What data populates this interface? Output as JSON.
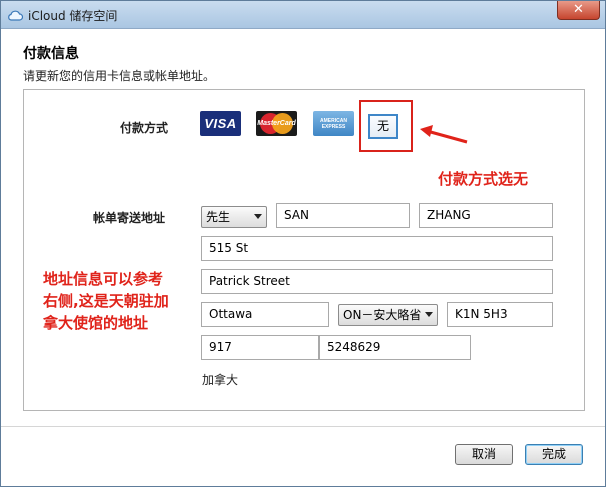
{
  "window": {
    "title": "iCloud 储存空间",
    "close_label": "✕"
  },
  "header": {
    "title": "付款信息",
    "subtitle": "请更新您的信用卡信息或帐单地址。"
  },
  "payment": {
    "label": "付款方式",
    "cards": {
      "visa": "VISA",
      "mastercard": "MasterCard",
      "amex_line1": "AMERICAN",
      "amex_line2": "EXPRESS"
    },
    "none_label": "无"
  },
  "billing": {
    "label": "帐单寄送地址",
    "salutation": "先生",
    "first_name": "SAN",
    "last_name": "ZHANG",
    "street1": "515 St",
    "street2": "Patrick Street",
    "city": "Ottawa",
    "province": "ON－安大略省",
    "postal_code": "K1N 5H3",
    "area_code": "917",
    "phone": "5248629",
    "country": "加拿大"
  },
  "annotations": {
    "payment_note": "付款方式选无",
    "address_note_line1": "地址信息可以参考",
    "address_note_line2": "右侧,这是天朝驻加",
    "address_note_line3": "拿大使馆的地址",
    "color": "#e0231a"
  },
  "buttons": {
    "cancel": "取消",
    "done": "完成"
  },
  "colors": {
    "title_bar": "#aac6e2",
    "accent_border": "#d9231b",
    "focus_blue": "#3e86c8"
  }
}
